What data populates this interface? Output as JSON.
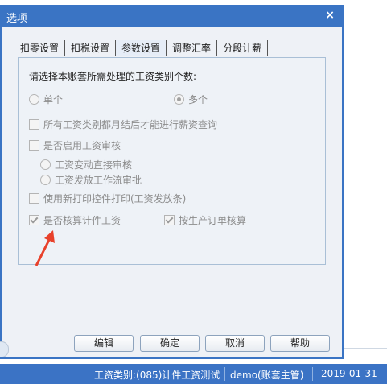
{
  "dialog": {
    "title": "选项",
    "close_glyph": "×"
  },
  "tabs": [
    "扣零设置",
    "扣税设置",
    "参数设置",
    "调整汇率",
    "分段计薪"
  ],
  "active_tab": "参数设置",
  "panel": {
    "prompt": "请选择本账套所需处理的工资类别个数:",
    "radio_single": "单个",
    "radio_multi": "多个",
    "multi_selected": true,
    "check_month_end": "所有工资类别都月结后才能进行薪资查询",
    "check_enable_audit": "是否启用工资审核",
    "radio_direct_audit": "工资变动直接审核",
    "radio_flow_approve": "工资发放工作流审批",
    "check_new_print": "使用新打印控件打印(工资发放条)",
    "check_piece_wage": "是否核算计件工资",
    "check_piece_wage_checked": true,
    "check_order": "按生产订单核算",
    "check_order_checked": true
  },
  "buttons": {
    "edit": "编辑",
    "ok": "确定",
    "cancel": "取消",
    "help": "帮助"
  },
  "statusbar": {
    "category": "工资类别:(085)计件工资测试",
    "user": "demo(账套主管)",
    "date": "2019-01-31"
  },
  "colors": {
    "titlebar": "#3a74c4",
    "statusbar": "#3b73c5",
    "annotation_arrow": "#e8412b"
  }
}
